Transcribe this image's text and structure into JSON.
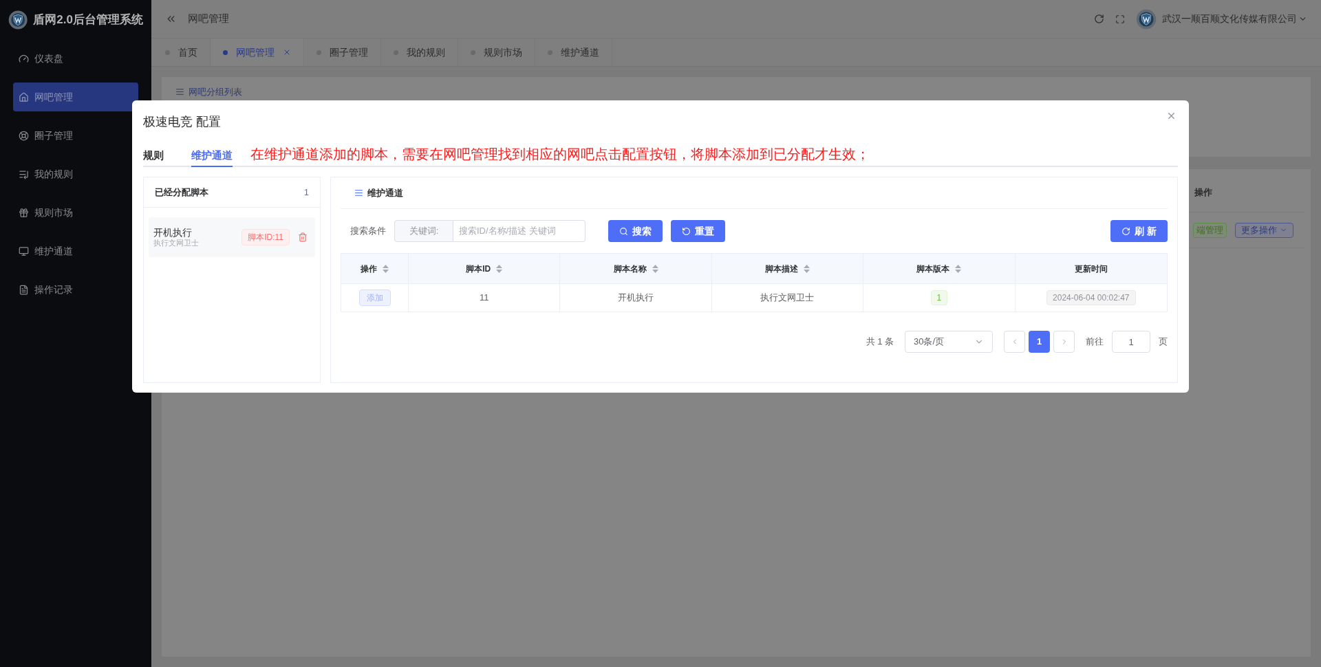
{
  "app": {
    "title": "盾网2.0后台管理系统"
  },
  "sidebar": {
    "items": [
      {
        "label": "仪表盘",
        "selected": false
      },
      {
        "label": "网吧管理",
        "selected": true
      },
      {
        "label": "圈子管理",
        "selected": false
      },
      {
        "label": "我的规则",
        "selected": false
      },
      {
        "label": "规则市场",
        "selected": false
      },
      {
        "label": "维护通道",
        "selected": false
      },
      {
        "label": "操作记录",
        "selected": false
      }
    ]
  },
  "header": {
    "breadcrumb": "网吧管理",
    "company": "武汉一顺百顺文化传媒有限公司"
  },
  "page_tabs": [
    {
      "label": "首页",
      "selected": false,
      "closable": false
    },
    {
      "label": "网吧管理",
      "selected": true,
      "closable": true
    },
    {
      "label": "圈子管理",
      "selected": false,
      "closable": false
    },
    {
      "label": "我的规则",
      "selected": false,
      "closable": false
    },
    {
      "label": "规则市场",
      "selected": false,
      "closable": false
    },
    {
      "label": "维护通道",
      "selected": false,
      "closable": false
    }
  ],
  "background": {
    "card_title": "网吧分组列表",
    "column_header": "操作",
    "row_buttons": [
      {
        "label": "端管理",
        "kind": "success"
      },
      {
        "label": "更多操作",
        "kind": "dropdown"
      }
    ]
  },
  "dialog": {
    "title": "极速电竞 配置",
    "tabs": [
      {
        "label": "规则",
        "selected": false
      },
      {
        "label": "维护通道",
        "selected": true
      }
    ],
    "notice": "在维护通道添加的脚本，需要在网吧管理找到相应的网吧点击配置按钮，将脚本添加到已分配才生效；",
    "assigned": {
      "title": "已经分配脚本",
      "count": "1",
      "items": [
        {
          "name": "开机执行",
          "description": "执行文网卫士",
          "tag": "脚本ID:11"
        }
      ]
    },
    "panel": {
      "title": "维护通道",
      "search": {
        "label": "搜索条件",
        "prefix": "关键词:",
        "placeholder": "搜索ID/名称/描述 关键词"
      },
      "buttons": {
        "search": "搜索",
        "reset": "重置",
        "refresh": "刷 新"
      },
      "table": {
        "columns": [
          {
            "label": "操作",
            "sortable": true
          },
          {
            "label": "脚本ID",
            "sortable": true
          },
          {
            "label": "脚本名称",
            "sortable": true
          },
          {
            "label": "脚本描述",
            "sortable": true
          },
          {
            "label": "脚本版本",
            "sortable": true
          },
          {
            "label": "更新时间",
            "sortable": false
          }
        ],
        "rows": [
          {
            "cells": [
              {
                "kind": "button",
                "text": "添加"
              },
              {
                "kind": "text",
                "text": "11"
              },
              {
                "kind": "text",
                "text": "开机执行"
              },
              {
                "kind": "text",
                "text": "执行文网卫士"
              },
              {
                "kind": "success",
                "text": "1"
              },
              {
                "kind": "info",
                "text": "2024-06-04 00:02:47"
              }
            ]
          }
        ]
      },
      "pagination": {
        "total": "共 1 条",
        "page_size": "30条/页",
        "pages": [
          {
            "label": "1",
            "selected": true
          }
        ],
        "goto_label": "前往",
        "goto_value": "1",
        "page_unit": "页"
      }
    }
  }
}
